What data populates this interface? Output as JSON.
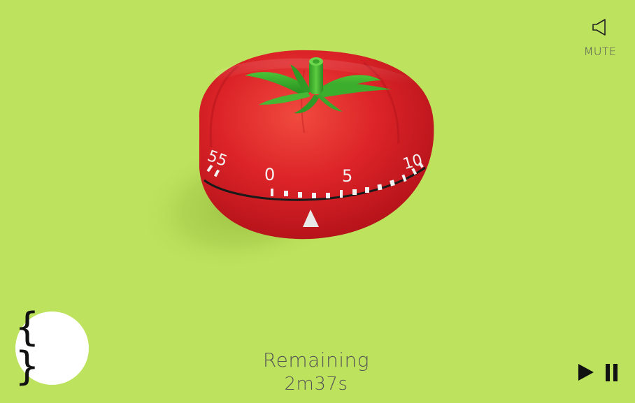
{
  "mute": {
    "label": "MUTE",
    "icon": "speaker-icon"
  },
  "dial": {
    "numbers": [
      "55",
      "0",
      "5",
      "10"
    ],
    "pointer_icon": "triangle-pointer-icon"
  },
  "logo": {
    "glyph": "{ }",
    "icon": "curly-braces-icon"
  },
  "status": {
    "label": "Remaining",
    "time": "2m37s"
  },
  "controls": {
    "play_icon": "play-icon",
    "pause_icon": "pause-icon"
  },
  "colors": {
    "background": "#bde35e",
    "tomato": "#d61f24",
    "leaf": "#3aa62c",
    "text": "#555555"
  }
}
